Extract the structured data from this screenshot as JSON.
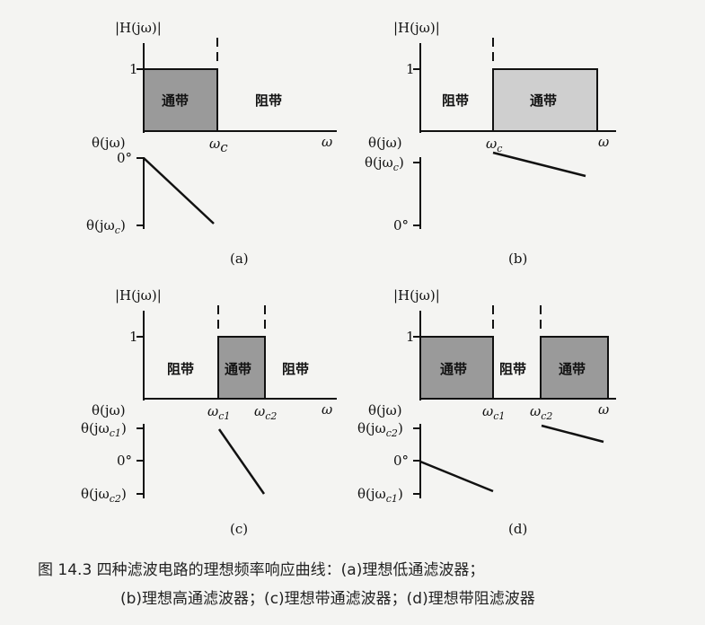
{
  "panels": {
    "a": {
      "mag_label": "|H(jω)|",
      "one": "1",
      "theta_label": "θ(jω)",
      "zero_deg": "0°",
      "theta_c": "θ(jω",
      "theta_c_sub": "c",
      "theta_c_end": ")",
      "omega_c": "ω",
      "omega_c_sub": "c",
      "omega": "ω",
      "pass": "通带",
      "stop": "阻带",
      "caption": "(a)"
    },
    "b": {
      "mag_label": "|H(jω)|",
      "one": "1",
      "theta_label": "θ(jω)",
      "zero_deg": "0°",
      "theta_c": "θ(jω",
      "theta_c_sub": "c",
      "theta_c_end": ")",
      "omega_c": "ω",
      "omega_c_sub": "c",
      "omega": "ω",
      "pass": "通带",
      "stop": "阻带",
      "caption": "(b)"
    },
    "c": {
      "mag_label": "|H(jω)|",
      "one": "1",
      "theta_label": "θ(jω)",
      "zero_deg": "0°",
      "theta_c1": "θ(jω",
      "theta_c1_sub": "c1",
      "theta_c1_end": ")",
      "theta_c2": "θ(jω",
      "theta_c2_sub": "c2",
      "theta_c2_end": ")",
      "omega_c1": "ω",
      "omega_c1_sub": "c1",
      "omega_c2": "ω",
      "omega_c2_sub": "c2",
      "omega": "ω",
      "pass": "通带",
      "stop_left": "阻带",
      "stop_right": "阻带",
      "caption": "(c)"
    },
    "d": {
      "mag_label": "|H(jω)|",
      "one": "1",
      "theta_label": "θ(jω)",
      "zero_deg": "0°",
      "theta_c2": "θ(jω",
      "theta_c2_sub": "c2",
      "theta_c2_end": ")",
      "theta_c1": "θ(jω",
      "theta_c1_sub": "c1",
      "theta_c1_end": ")",
      "omega_c1": "ω",
      "omega_c1_sub": "c1",
      "omega_c2": "ω",
      "omega_c2_sub": "c2",
      "omega": "ω",
      "pass_left": "通带",
      "stop": "阻带",
      "pass_right": "通带",
      "caption": "(d)"
    }
  },
  "caption": {
    "line1": "图 14.3   四种滤波电路的理想频率响应曲线：(a)理想低通滤波器；",
    "line2": "(b)理想高通滤波器；(c)理想带通滤波器；(d)理想带阻滤波器"
  },
  "colors": {
    "pass_fill": "#9a9a9a",
    "pass_fill_light": "#cfcfcf",
    "line": "#111111"
  }
}
